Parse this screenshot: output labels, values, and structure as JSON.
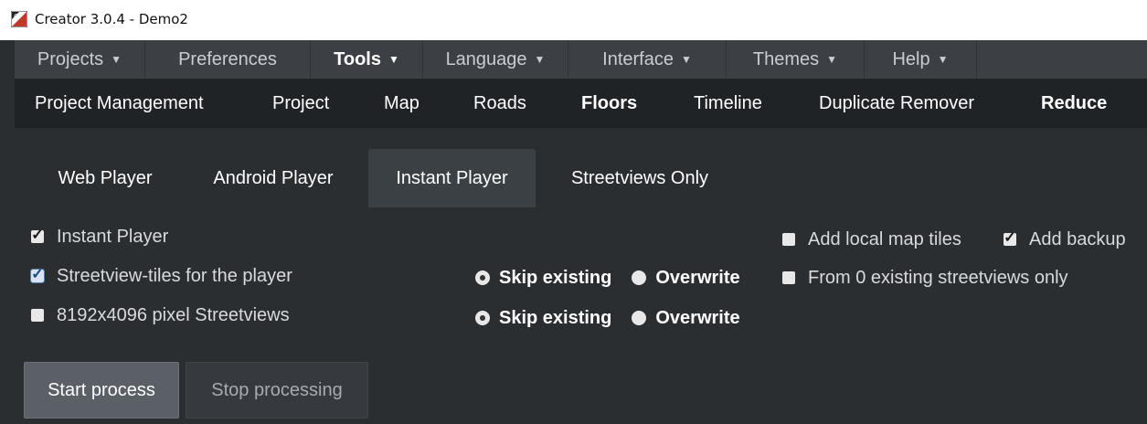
{
  "window": {
    "title": "Creator 3.0.4 - Demo2",
    "icon": "app-logo-icon"
  },
  "menubar": {
    "items": [
      {
        "label": "Projects",
        "has_dropdown": true,
        "bold": false
      },
      {
        "label": "Preferences",
        "has_dropdown": false,
        "bold": false
      },
      {
        "label": "Tools",
        "has_dropdown": true,
        "bold": true
      },
      {
        "label": "Language",
        "has_dropdown": true,
        "bold": false
      },
      {
        "label": "Interface",
        "has_dropdown": true,
        "bold": false
      },
      {
        "label": "Themes",
        "has_dropdown": true,
        "bold": false
      },
      {
        "label": "Help",
        "has_dropdown": true,
        "bold": false
      }
    ],
    "caret": "▼"
  },
  "toolbar": {
    "items": [
      {
        "label": "Project Management",
        "bold": false
      },
      {
        "label": "Project",
        "bold": false
      },
      {
        "label": "Map",
        "bold": false
      },
      {
        "label": "Roads",
        "bold": false
      },
      {
        "label": "Floors",
        "bold": true
      },
      {
        "label": "Timeline",
        "bold": false
      },
      {
        "label": "Duplicate Remover",
        "bold": false
      },
      {
        "label": "Reduce",
        "bold": true
      }
    ]
  },
  "tabs": {
    "items": [
      {
        "label": "Web Player",
        "active": false
      },
      {
        "label": "Android Player",
        "active": false
      },
      {
        "label": "Instant Player",
        "active": true
      },
      {
        "label": "Streetviews Only",
        "active": false
      }
    ]
  },
  "options": {
    "instant_player": {
      "label": "Instant Player",
      "checked": true
    },
    "streetview_tiles": {
      "label": "Streetview-tiles for the player",
      "checked": true
    },
    "pixel_streetviews": {
      "label": "8192x4096 pixel Streetviews",
      "checked": false
    },
    "add_local_map_tiles": {
      "label": "Add local map tiles",
      "checked": false
    },
    "add_backup": {
      "label": "Add backup",
      "checked": true
    },
    "from_existing": {
      "label": "From 0 existing streetviews only",
      "checked": false
    },
    "tiles_mode": {
      "skip_label": "Skip existing",
      "overwrite_label": "Overwrite",
      "selected": "skip"
    },
    "pixel_mode": {
      "skip_label": "Skip existing",
      "overwrite_label": "Overwrite",
      "selected": "skip"
    }
  },
  "actions": {
    "start_label": "Start process",
    "stop_label": "Stop processing"
  },
  "colors": {
    "menubar_bg": "#3c4044",
    "toolbar_bg": "#202326",
    "panel_bg": "#2b2e31",
    "active_tab_bg": "#3b4044"
  }
}
